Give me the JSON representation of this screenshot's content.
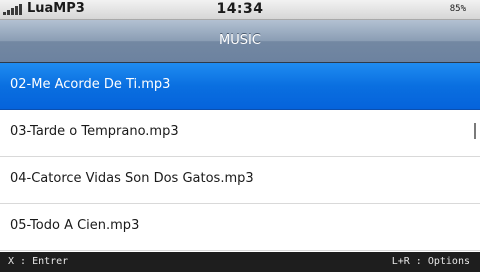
{
  "status": {
    "carrier": "LuaMP3",
    "time": "14:34",
    "battery": "85%",
    "signal_icon": "signal-bars-icon"
  },
  "header": {
    "title": "MUSIC"
  },
  "tracks": [
    {
      "label": "02-Me Acorde De Ti.mp3",
      "selected": true
    },
    {
      "label": "03-Tarde o Temprano.mp3",
      "selected": false
    },
    {
      "label": "04-Catorce Vidas Son Dos Gatos.mp3",
      "selected": false
    },
    {
      "label": "05-Todo A Cien.mp3",
      "selected": false
    }
  ],
  "footer": {
    "left_hint": "X : Entrer",
    "right_hint": "L+R : Options"
  },
  "colors": {
    "selection": "#0a6fe0",
    "title_bar": "#8a9db4"
  }
}
